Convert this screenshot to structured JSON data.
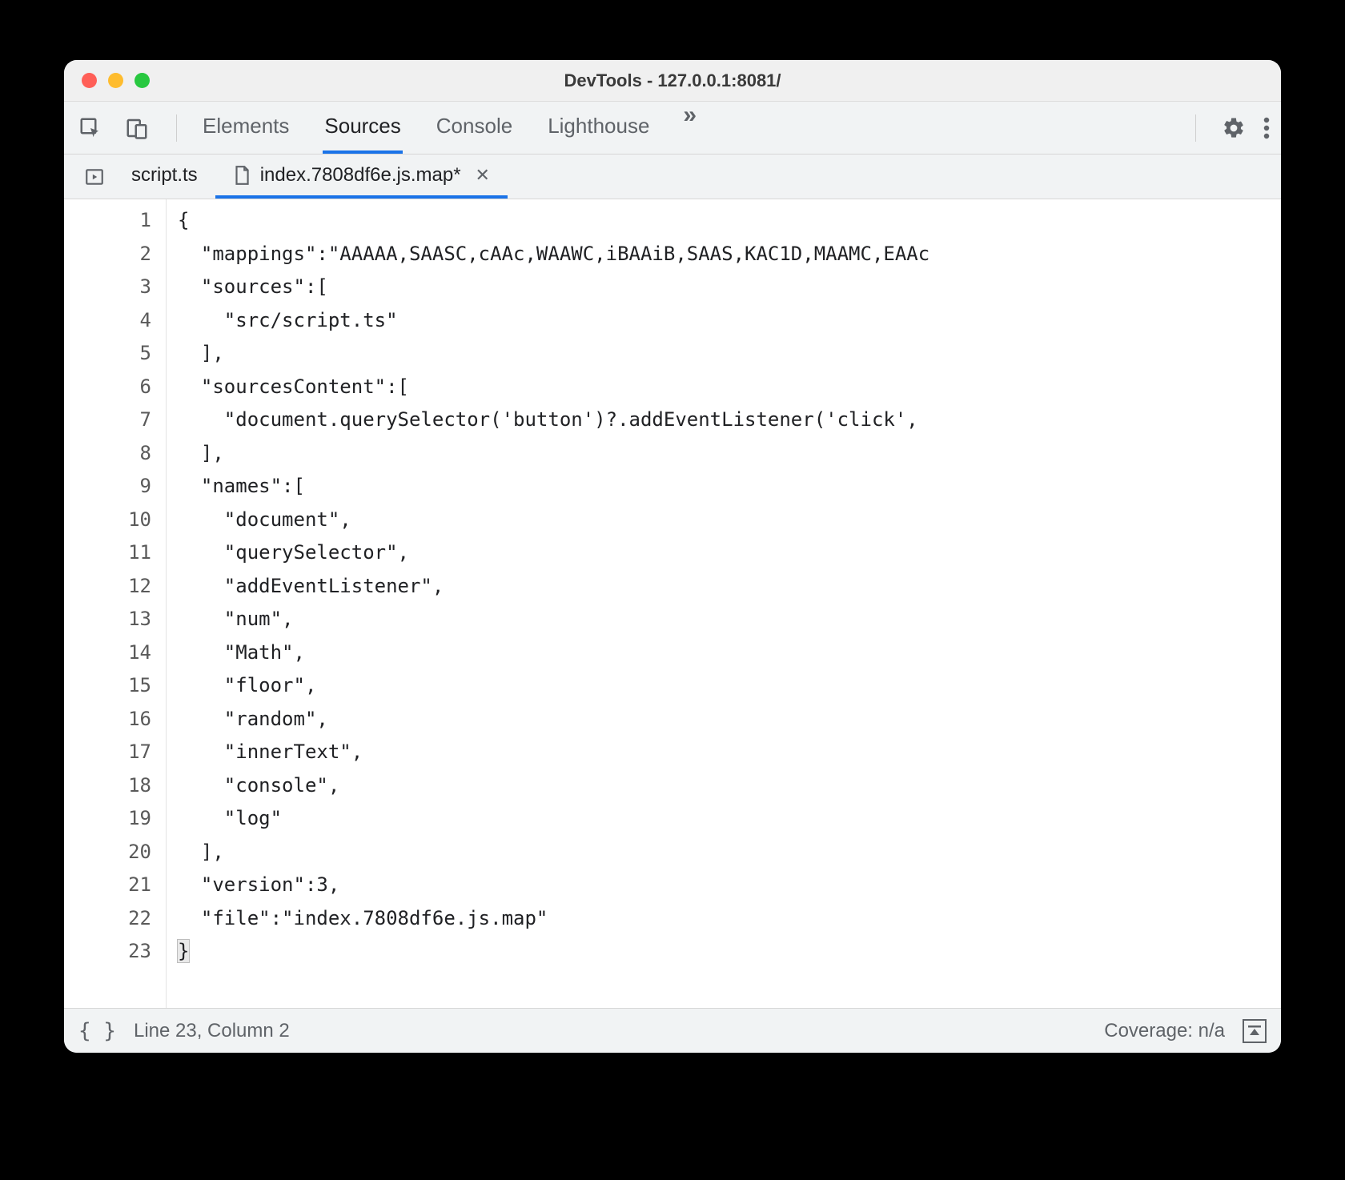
{
  "window": {
    "title": "DevTools - 127.0.0.1:8081/"
  },
  "toolbar": {
    "tabs": [
      {
        "label": "Elements",
        "active": false
      },
      {
        "label": "Sources",
        "active": true
      },
      {
        "label": "Console",
        "active": false
      },
      {
        "label": "Lighthouse",
        "active": false
      }
    ],
    "more_glyph": "»"
  },
  "filetabs": [
    {
      "label": "script.ts",
      "active": false,
      "closable": false,
      "icon": false
    },
    {
      "label": "index.7808df6e.js.map*",
      "active": true,
      "closable": true,
      "icon": true
    }
  ],
  "code_lines": [
    "{",
    "  \"mappings\":\"AAAAA,SAASC,cAAc,WAAWC,iBAAiB,SAAS,KAC1D,MAAMC,EAAc",
    "  \"sources\":[",
    "    \"src/script.ts\"",
    "  ],",
    "  \"sourcesContent\":[",
    "    \"document.querySelector('button')?.addEventListener('click',",
    "  ],",
    "  \"names\":[",
    "    \"document\",",
    "    \"querySelector\",",
    "    \"addEventListener\",",
    "    \"num\",",
    "    \"Math\",",
    "    \"floor\",",
    "    \"random\",",
    "    \"innerText\",",
    "    \"console\",",
    "    \"log\"",
    "  ],",
    "  \"version\":3,",
    "  \"file\":\"index.7808df6e.js.map\"",
    "}"
  ],
  "status": {
    "cursor": "Line 23, Column 2",
    "coverage": "Coverage: n/a"
  }
}
